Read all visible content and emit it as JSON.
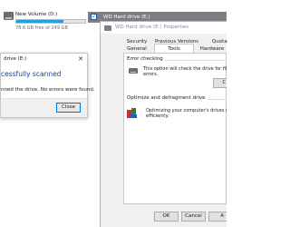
{
  "explorer": {
    "drive_name": "New Volume (D:)",
    "drive_free": "78.6 GB free of 249 GB",
    "drive_used_fraction": 0.68,
    "selected_drive": "WD Hard drive (E:)",
    "selected_check": "✓"
  },
  "scan_dialog": {
    "title": "drive (E:)",
    "close_x": "✕",
    "heading": "cessfully scanned",
    "message": "nned the drive. No errors were found.",
    "close_button": "Close"
  },
  "properties": {
    "title": "WD Hard drive (E:) Properties",
    "tabs_row1": [
      "Security",
      "Previous Versions",
      "Quota"
    ],
    "tabs_row2": [
      "General",
      "Tools",
      "Hardware"
    ],
    "active_tab": "Tools",
    "error_checking": {
      "group_label": "Error checking",
      "line1": "This option will check the drive for file syste",
      "line2": "errors.",
      "check_button": "C"
    },
    "optimize": {
      "group_label": "Optimize and defragment drive",
      "line1": "Optimizing your computer's drives can hel",
      "line2": "efficiently."
    },
    "buttons": {
      "ok": "OK",
      "cancel": "Cancel",
      "apply": "A"
    }
  },
  "icons": {
    "drive": "hard-drive-icon",
    "optimize": "defragment-icon"
  }
}
